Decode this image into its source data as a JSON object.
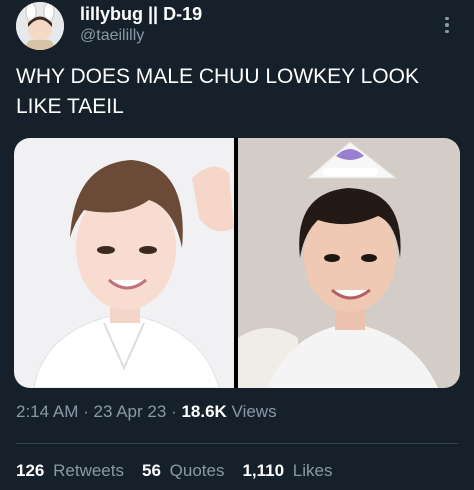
{
  "colors": {
    "background": "#15202b",
    "text_primary": "#ffffff",
    "text_secondary": "#8b98a5",
    "divider": "#38444d"
  },
  "author": {
    "display_name": "lillybug || D-19",
    "handle": "@taeililly",
    "avatar_icon": "avatar-image"
  },
  "tweet": {
    "text_line1": "WHY DOES MALE CHUU LOWKEY LOOK",
    "text_line2": "LIKE TAEIL"
  },
  "media": {
    "count": 2,
    "icon_more": "more-dots-icon"
  },
  "meta": {
    "time": "2:14 AM",
    "separator": "·",
    "date": "23 Apr 23",
    "views_count": "18.6K",
    "views_label": "Views"
  },
  "stats": {
    "retweets_count": "126",
    "retweets_label": "Retweets",
    "quotes_count": "56",
    "quotes_label": "Quotes",
    "likes_count": "1,110",
    "likes_label": "Likes"
  }
}
